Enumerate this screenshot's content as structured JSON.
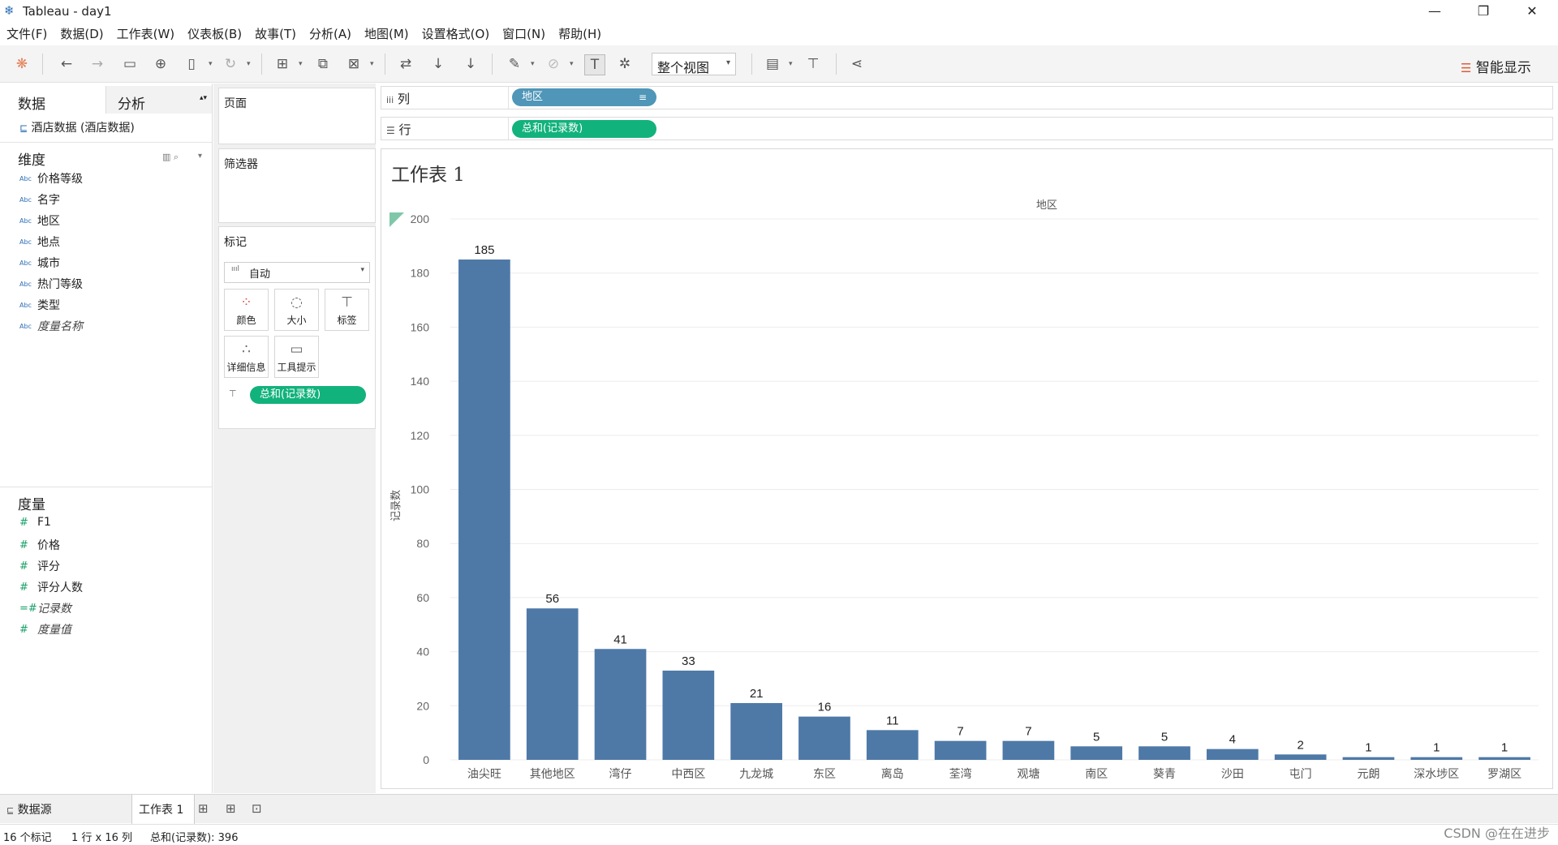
{
  "window": {
    "title": "Tableau - day1"
  },
  "menu": [
    "文件(F)",
    "数据(D)",
    "工作表(W)",
    "仪表板(B)",
    "故事(T)",
    "分析(A)",
    "地图(M)",
    "设置格式(O)",
    "窗口(N)",
    "帮助(H)"
  ],
  "toolbar": {
    "fit_view": "整个视图",
    "show_me": "智能显示"
  },
  "data_pane": {
    "tab_data": "数据",
    "tab_analysis": "分析",
    "datasource": "酒店数据 (酒店数据)",
    "dimensions_header": "维度",
    "dimensions": [
      "价格等级",
      "名字",
      "地区",
      "地点",
      "城市",
      "热门等级",
      "类型",
      "度量名称"
    ],
    "measures_header": "度量",
    "measures": [
      "F1",
      "价格",
      "评分",
      "评分人数",
      "记录数",
      "度量值"
    ],
    "abc": "Abc"
  },
  "shelves": {
    "pages": "页面",
    "filters": "筛选器",
    "marks": "标记",
    "mark_type": "自动",
    "mark_buttons": [
      "颜色",
      "大小",
      "标签",
      "详细信息",
      "工具提示"
    ],
    "marks_pill": "总和(记录数)",
    "columns_label": "列",
    "rows_label": "行",
    "columns_pill": "地区",
    "rows_pill": "总和(记录数)"
  },
  "viz": {
    "sheet_title": "工作表 1",
    "x_header": "地区",
    "y_axis_label": "记录数"
  },
  "chart_data": {
    "type": "bar",
    "categories": [
      "油尖旺",
      "其他地区",
      "湾仔",
      "中西区",
      "九龙城",
      "东区",
      "离岛",
      "荃湾",
      "观塘",
      "南区",
      "葵青",
      "沙田",
      "屯门",
      "元朗",
      "深水埗区",
      "罗湖区"
    ],
    "values": [
      185,
      56,
      41,
      33,
      21,
      16,
      11,
      7,
      7,
      5,
      5,
      4,
      2,
      1,
      1,
      1
    ],
    "title": "工作表 1",
    "xlabel": "地区",
    "ylabel": "记录数",
    "ylim": [
      0,
      200
    ],
    "yticks": [
      0,
      20,
      40,
      60,
      80,
      100,
      120,
      140,
      160,
      180,
      200
    ],
    "bar_color": "#4e79a7",
    "grid": true
  },
  "sheet_tabs": {
    "datasource": "数据源",
    "sheet": "工作表 1"
  },
  "status": {
    "marks": "16 个标记",
    "dims": "1 行 x 16 列",
    "sum": "总和(记录数): 396"
  },
  "watermark": "CSDN @在在进步",
  "colors": {
    "dim_pill": "#4f96b8",
    "measure_pill": "#12b27c",
    "bar": "#4e79a7"
  }
}
